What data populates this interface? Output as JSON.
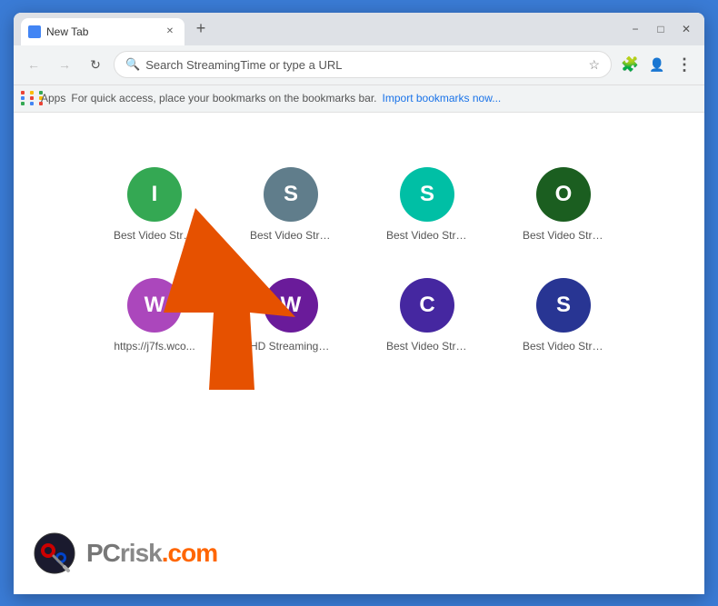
{
  "window": {
    "title": "New Tab",
    "minimize_label": "−",
    "restore_label": "□",
    "close_label": "✕",
    "new_tab_label": "+"
  },
  "navbar": {
    "back_label": "←",
    "forward_label": "→",
    "reload_label": "↻",
    "address_placeholder": "Search StreamingTime or type a URL",
    "star_label": "☆",
    "profile_label": "👤",
    "menu_label": "⋮",
    "extension_label": "⊕"
  },
  "bookmarks_bar": {
    "apps_label": "Apps",
    "message": "For quick access, place your bookmarks on the bookmarks bar.",
    "import_link": "Import bookmarks now..."
  },
  "shortcuts": {
    "row1": [
      {
        "id": "s1",
        "letter": "I",
        "color": "#34a853",
        "label": "Best Video Stre..."
      },
      {
        "id": "s2",
        "letter": "S",
        "color": "#607d8b",
        "label": "Best Video Stre..."
      },
      {
        "id": "s3",
        "letter": "S",
        "color": "#00bfa5",
        "label": "Best Video Stre..."
      },
      {
        "id": "s4",
        "letter": "O",
        "color": "#1b5e20",
        "label": "Best Video Stre..."
      }
    ],
    "row2": [
      {
        "id": "s5",
        "letter": "W",
        "color": "#ab47bc",
        "label": "https://j7fs.wco..."
      },
      {
        "id": "s6",
        "letter": "W",
        "color": "#6a1b9a",
        "label": "HD Streaming -..."
      },
      {
        "id": "s7",
        "letter": "C",
        "color": "#4527a0",
        "label": "Best Video Stre..."
      },
      {
        "id": "s8",
        "letter": "S",
        "color": "#283593",
        "label": "Best Video Stre..."
      }
    ]
  },
  "pcrisk": {
    "text_pc": "PC",
    "text_risk": "risk",
    "text_com": ".com"
  },
  "apps_dots": [
    {
      "color": "#ea4335"
    },
    {
      "color": "#fbbc04"
    },
    {
      "color": "#34a853"
    },
    {
      "color": "#4285f4"
    },
    {
      "color": "#ea4335"
    },
    {
      "color": "#fbbc04"
    },
    {
      "color": "#34a853"
    },
    {
      "color": "#4285f4"
    },
    {
      "color": "#ea4335"
    }
  ]
}
